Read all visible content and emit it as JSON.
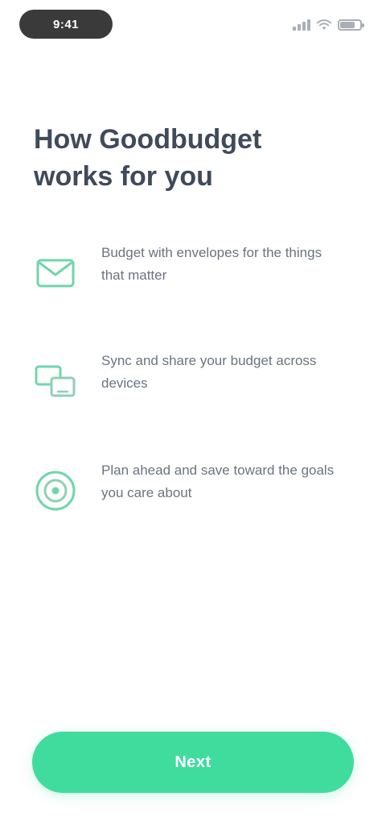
{
  "status_bar": {
    "time": "9:41",
    "icons": [
      "signal-icon",
      "wifi-icon",
      "battery-icon"
    ]
  },
  "title": "How Goodbudget works for you",
  "features": [
    {
      "icon": "envelope-icon",
      "text": "Budget with envelopes for the things that matter"
    },
    {
      "icon": "sync-icon",
      "text": "Sync and share your budget across devices"
    },
    {
      "icon": "target-icon",
      "text": "Plan ahead and save toward the goals you care about"
    }
  ],
  "cta": {
    "label": "Next"
  },
  "colors": {
    "accent": "#3fdc9e",
    "title": "#3f4a5a",
    "body_text": "#6a7480",
    "icon": "#6fd6ac"
  }
}
